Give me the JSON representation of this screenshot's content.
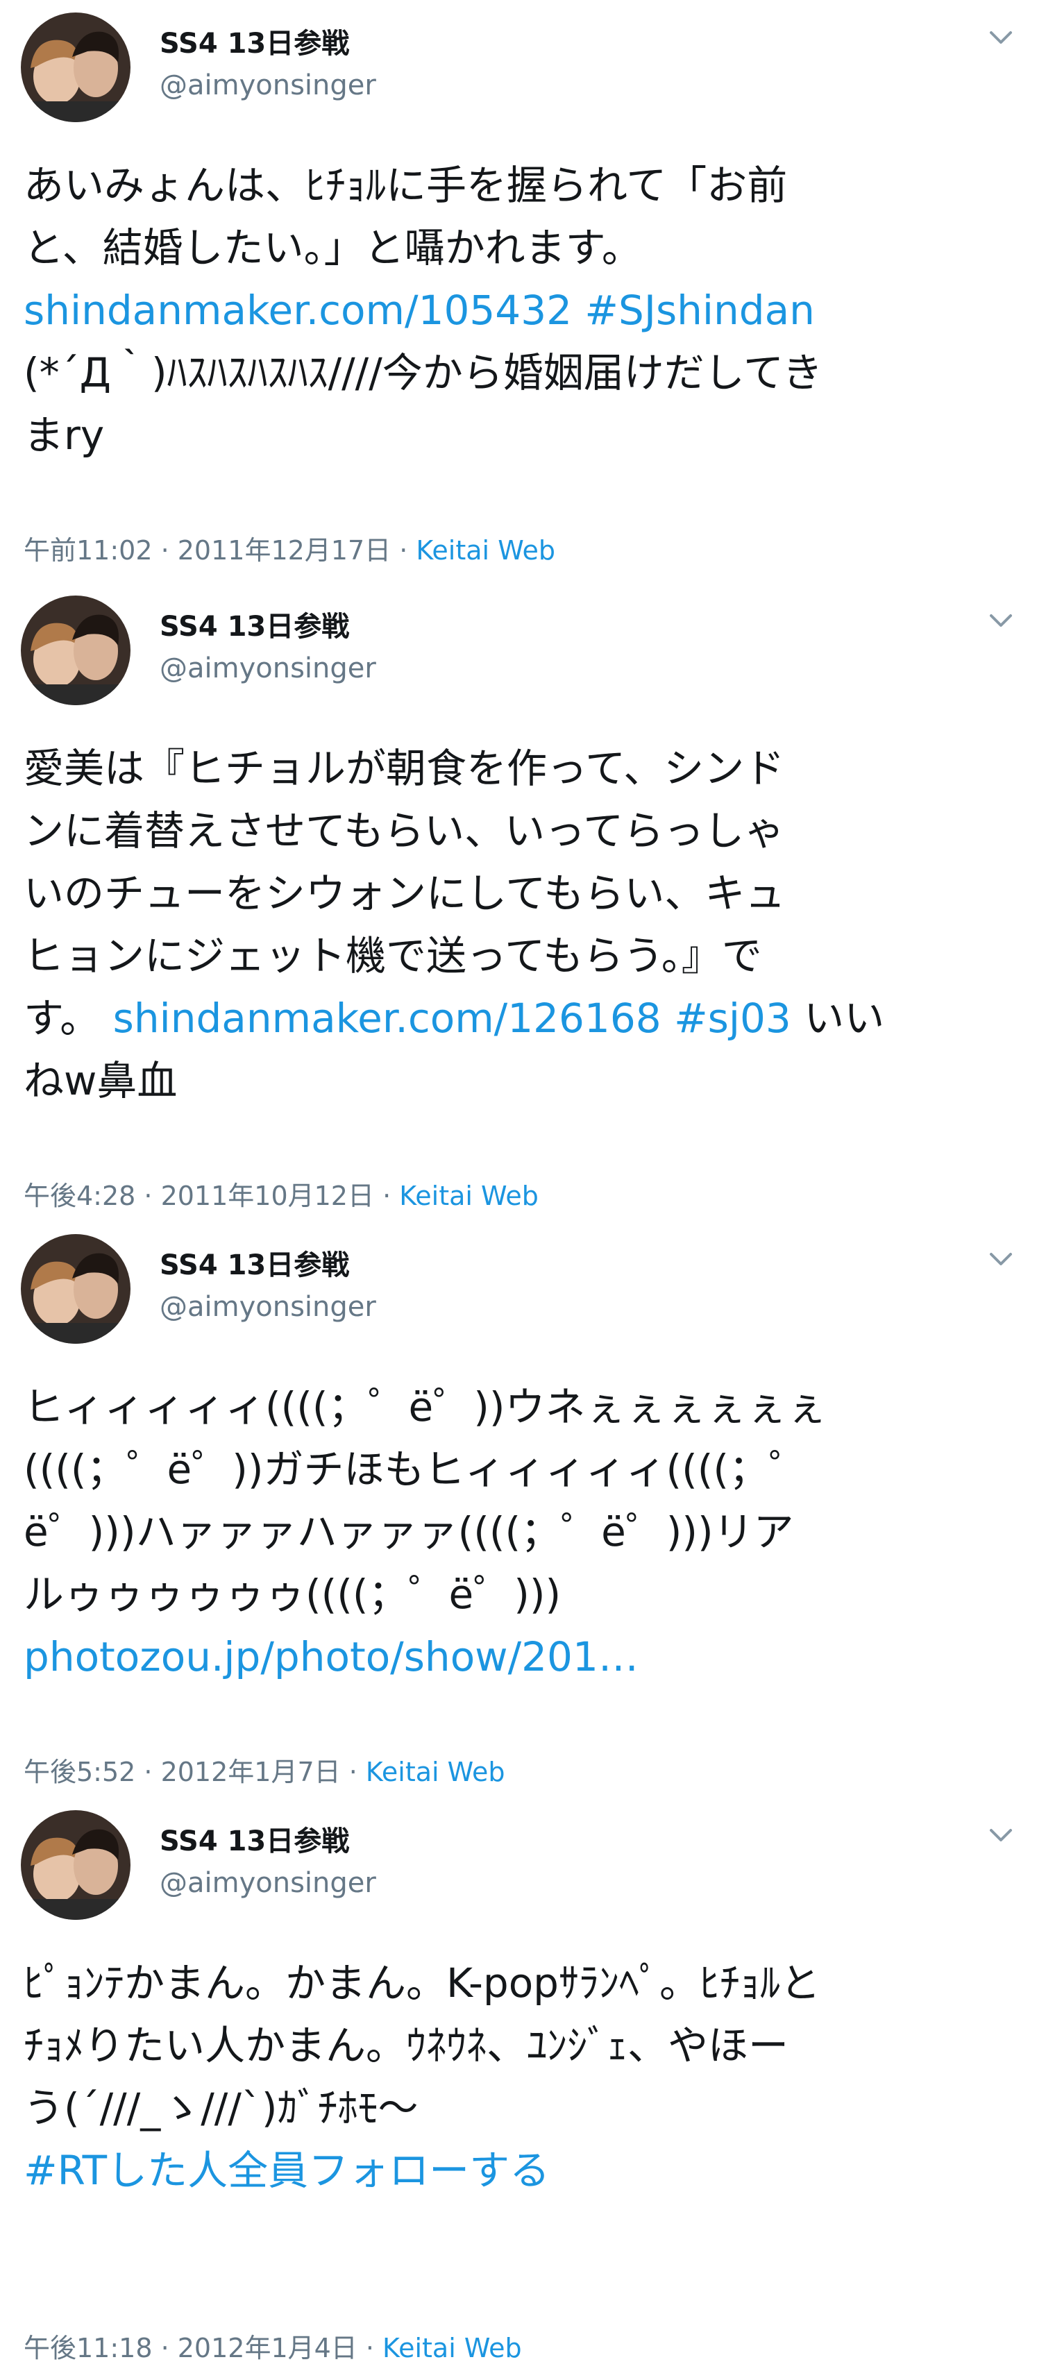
{
  "tweets": [
    {
      "name": "SS4 13日参戦",
      "handle": "@aimyonsinger",
      "lines": [
        {
          "text": "あいみょんは、ﾋﾁｮﾙに手を握られて「お前"
        },
        {
          "text": "と、結婚したい。」と囁かれます。"
        },
        {
          "link": "shindanmaker.com/105432 #SJshindan"
        },
        {
          "text": "(*´Д｀)ﾊｽﾊｽﾊｽﾊｽ////今から婚姻届けだしてき"
        },
        {
          "text": "まry"
        }
      ],
      "time": "午前11:02 · 2011年12月17日 · ",
      "source": "Keitai Web"
    },
    {
      "name": "SS4 13日参戦",
      "handle": "@aimyonsinger",
      "lines": [
        {
          "text": "愛美は『ヒチョルが朝食を作って、シンド"
        },
        {
          "text": "ンに着替えさせてもらい、いってらっしゃ"
        },
        {
          "text": "いのチューをシウォンにしてもらい、キュ"
        },
        {
          "text": "ヒョンにジェット機で送ってもらう。』で"
        },
        {
          "text": "す。 ",
          "link": "shindanmaker.com/126168 #sj03",
          "after": "  いい"
        },
        {
          "text": "ねw鼻血"
        }
      ],
      "time": "午後4:28 · 2011年10月12日 · ",
      "source": "Keitai Web"
    },
    {
      "name": "SS4 13日参戦",
      "handle": "@aimyonsinger",
      "lines": [
        {
          "text": "ヒィィィィィ((((；゜ë゜))ウネぇぇぇぇぇぇ"
        },
        {
          "text": "((((；゜ë゜))ガチほもヒィィィィィ((((；゜"
        },
        {
          "text": "ë゜)))ハァァァハァァァ((((；゜ë゜)))リア"
        },
        {
          "text": "ルゥゥゥゥゥゥ((((；゜ë゜)))"
        },
        {
          "link": "photozou.jp/photo/show/201…"
        }
      ],
      "time": "午後5:52 · 2012年1月7日 · ",
      "source": "Keitai Web"
    },
    {
      "name": "SS4 13日参戦",
      "handle": "@aimyonsinger",
      "lines": [
        {
          "text": "ﾋﾟｮﾝﾃかまん。かまん。K-popｻﾗﾝﾍﾟ。ﾋﾁｮﾙと"
        },
        {
          "text": "ﾁｮﾒりたい人かまん。ｳﾈｳﾈ、ﾕﾝｼﾞｪ、やほー"
        },
        {
          "text": "う(´///_ゝ///`)ｶﾞﾁﾎﾓ〜"
        },
        {
          "text": " "
        },
        {
          "link": "#RTした人全員フォローする"
        }
      ],
      "time": "午後11:18 · 2012年1月4日 · ",
      "source": "Keitai Web"
    }
  ],
  "icons": {
    "avatar": "avatar-photo",
    "menu": "chevron-down-icon"
  },
  "colors": {
    "link": "#1b95e0",
    "text": "#14171a",
    "muted": "#657786"
  }
}
